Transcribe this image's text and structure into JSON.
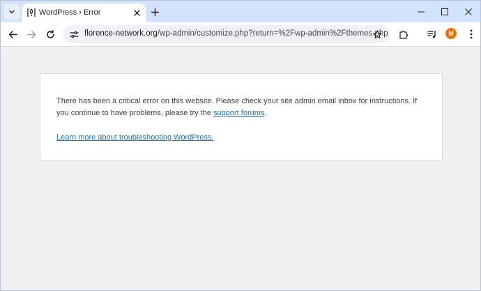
{
  "tab": {
    "title": "WordPress › Error"
  },
  "address_bar": {
    "url_domain": "florence-network.org",
    "url_path": "/wp-admin/customize.php?return=%2Fwp-admin%2Fthemes.php"
  },
  "profile": {
    "initial": "M",
    "color": "#e8710a"
  },
  "error": {
    "message_before": "There has been a critical error on this website. Please check your site admin email inbox for instructions. If you continue to have problems, please try the ",
    "support_link": "support forums",
    "message_after": ".",
    "learn_more_link": "Learn more about troubleshooting WordPress."
  },
  "colors": {
    "tabstrip": "#d3e3fd",
    "link": "#2271b1",
    "page_bg": "#f0f0f1"
  },
  "icons": {
    "tab_search": "chevron-down-icon",
    "favicon": "wordpress-error-favicon",
    "tab_close": "close-icon",
    "new_tab": "plus-icon",
    "back": "arrow-left-icon",
    "forward": "arrow-right-icon",
    "reload": "reload-icon",
    "site_info": "tune-icon",
    "bookmark": "star-icon",
    "extensions": "puzzle-icon",
    "media": "media-queue-icon",
    "menu": "kebab-menu-icon"
  }
}
